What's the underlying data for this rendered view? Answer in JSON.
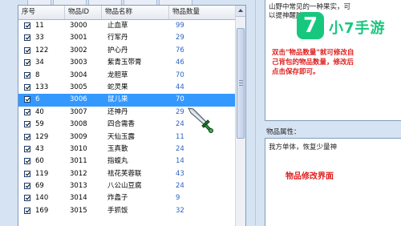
{
  "columns": {
    "seq": "序号",
    "id": "物品ID",
    "name": "物品名称",
    "qty": "物品数量"
  },
  "rows": [
    {
      "seq": "11",
      "id": "3000",
      "name": "止血草",
      "qty": "99"
    },
    {
      "seq": "33",
      "id": "3001",
      "name": "行军丹",
      "qty": "29"
    },
    {
      "seq": "122",
      "id": "3002",
      "name": "护心丹",
      "qty": "76"
    },
    {
      "seq": "34",
      "id": "3003",
      "name": "紫青玉带膏",
      "qty": "46"
    },
    {
      "seq": "8",
      "id": "3004",
      "name": "龙胆草",
      "qty": "70"
    },
    {
      "seq": "133",
      "id": "3005",
      "name": "蛇灵果",
      "qty": "44"
    },
    {
      "seq": "6",
      "id": "3006",
      "name": "鼠儿果",
      "qty": "70",
      "selected": true
    },
    {
      "seq": "40",
      "id": "3007",
      "name": "还神丹",
      "qty": "29"
    },
    {
      "seq": "59",
      "id": "3008",
      "name": "四合需香",
      "qty": "24"
    },
    {
      "seq": "129",
      "id": "3009",
      "name": "天仙玉露",
      "qty": "11"
    },
    {
      "seq": "43",
      "id": "3010",
      "name": "玉真散",
      "qty": "24"
    },
    {
      "seq": "60",
      "id": "3011",
      "name": "指蝮丸",
      "qty": "14"
    },
    {
      "seq": "119",
      "id": "3012",
      "name": "祛花芙蓉联",
      "qty": "43"
    },
    {
      "seq": "69",
      "id": "3013",
      "name": "八公山豆腐",
      "qty": "24"
    },
    {
      "seq": "140",
      "id": "3014",
      "name": "炸蠡子",
      "qty": "9"
    },
    {
      "seq": "169",
      "id": "3015",
      "name": "手抓饭",
      "qty": "32"
    }
  ],
  "description": {
    "text": "山野中常见的一种果实，可以提神醒脑。",
    "note": "双击\"物品数量\"就可修改自己背包的物品数量，修改后点击保存即可。"
  },
  "logo": {
    "badge": "7",
    "brand": "小7手游"
  },
  "attributes": {
    "label": "物品属性：",
    "text": "我方单体，恢复少量神",
    "note": "物品修改界面"
  },
  "colors": {
    "selection": "#3399ff",
    "qty_text": "#2d63c2",
    "note_red": "#e02020",
    "brand_green": "#18c77e"
  },
  "icons": {
    "cursor": "sword-cursor-icon",
    "checkbox": "checkbox-icon"
  }
}
